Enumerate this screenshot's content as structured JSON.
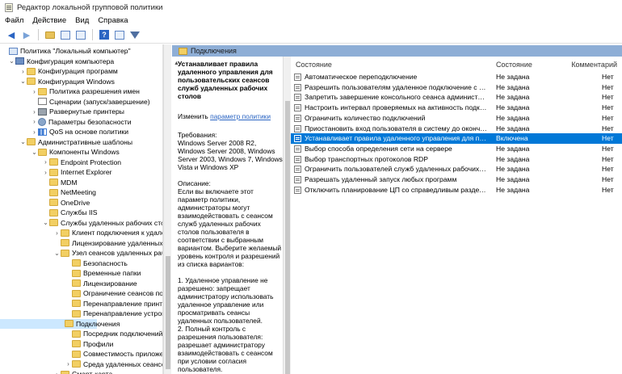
{
  "window": {
    "title": "Редактор локальной групповой политики"
  },
  "menu": [
    "Файл",
    "Действие",
    "Вид",
    "Справка"
  ],
  "tree": [
    {
      "label": "Политика \"Локальный компьютер\"",
      "level": 0,
      "chev": "",
      "icon": "policy"
    },
    {
      "label": "Конфигурация компьютера",
      "level": 1,
      "chev": "⌄",
      "icon": "pc"
    },
    {
      "label": "Конфигурация программ",
      "level": 2,
      "chev": "›",
      "icon": "folder"
    },
    {
      "label": "Конфигурация Windows",
      "level": 2,
      "chev": "⌄",
      "icon": "folder"
    },
    {
      "label": "Политика разрешения имен",
      "level": 3,
      "chev": "›",
      "icon": "folder"
    },
    {
      "label": "Сценарии (запуск/завершение)",
      "level": 3,
      "chev": "",
      "icon": "doc"
    },
    {
      "label": "Развернутые принтеры",
      "level": 3,
      "chev": "›",
      "icon": "printer"
    },
    {
      "label": "Параметры безопасности",
      "level": 3,
      "chev": "›",
      "icon": "gear"
    },
    {
      "label": "QoS на основе политики",
      "level": 3,
      "chev": "›",
      "icon": "chart"
    },
    {
      "label": "Административные шаблоны",
      "level": 2,
      "chev": "⌄",
      "icon": "folder"
    },
    {
      "label": "Компоненты Windows",
      "level": 3,
      "chev": "⌄",
      "icon": "folder"
    },
    {
      "label": "Endpoint Protection",
      "level": 4,
      "chev": "›",
      "icon": "folder"
    },
    {
      "label": "Internet Explorer",
      "level": 4,
      "chev": "›",
      "icon": "folder"
    },
    {
      "label": "MDM",
      "level": 4,
      "chev": "",
      "icon": "folder"
    },
    {
      "label": "NetMeeting",
      "level": 4,
      "chev": "",
      "icon": "folder"
    },
    {
      "label": "OneDrive",
      "level": 4,
      "chev": "",
      "icon": "folder"
    },
    {
      "label": "Службы IIS",
      "level": 4,
      "chev": "",
      "icon": "folder"
    },
    {
      "label": "Службы удаленных рабочих стол",
      "level": 4,
      "chev": "⌄",
      "icon": "folder"
    },
    {
      "label": "Клиент подключения к удале",
      "level": 5,
      "chev": "›",
      "icon": "folder"
    },
    {
      "label": "Лицензирование удаленных р",
      "level": 5,
      "chev": "",
      "icon": "folder"
    },
    {
      "label": "Узел сеансов удаленных рабс",
      "level": 5,
      "chev": "⌄",
      "icon": "folder"
    },
    {
      "label": "Безопасность",
      "level": 6,
      "chev": "",
      "icon": "folder"
    },
    {
      "label": "Временные папки",
      "level": 6,
      "chev": "",
      "icon": "folder"
    },
    {
      "label": "Лицензирование",
      "level": 6,
      "chev": "",
      "icon": "folder"
    },
    {
      "label": "Ограничение сеансов по",
      "level": 6,
      "chev": "",
      "icon": "folder"
    },
    {
      "label": "Перенаправление принте",
      "level": 6,
      "chev": "",
      "icon": "folder"
    },
    {
      "label": "Перенаправление устрой",
      "level": 6,
      "chev": "",
      "icon": "folder"
    },
    {
      "label": "Подключения",
      "level": 6,
      "chev": "",
      "icon": "folder",
      "selected": true
    },
    {
      "label": "Посредник подключений",
      "level": 6,
      "chev": "",
      "icon": "folder"
    },
    {
      "label": "Профили",
      "level": 6,
      "chev": "",
      "icon": "folder"
    },
    {
      "label": "Совместимость приложе",
      "level": 6,
      "chev": "",
      "icon": "folder"
    },
    {
      "label": "Среда удаленных сеансов",
      "level": 6,
      "chev": "›",
      "icon": "folder"
    },
    {
      "label": "Смарт-карта",
      "level": 5,
      "chev": "›",
      "icon": "folder"
    }
  ],
  "header": {
    "folder_label": "Подключения"
  },
  "description": {
    "policy_name": "Устанавливает правила удаленного управления для пользовательских сеансов служб удаленных рабочих столов",
    "edit_prefix": "Изменить ",
    "edit_link": "параметр политики",
    "requirements": "Требования:\nWindows Server 2008 R2, Windows Server 2008, Windows Server 2003, Windows 7, Windows Vista и Windows XP",
    "description": "Описание:\nЕсли вы включаете этот параметр политики, администраторы могут взаимодействовать с сеансом служб удаленных рабочих столов пользователя в соответствии с выбранным вариантом. Выберите желаемый уровень контроля и разрешений из списка вариантов:\n\n1. Удаленное управление не разрешено: запрещает администратору использовать удаленное управление или просматривать сеансы удаленных пользователей.\n2. Полный контроль с разрешения пользователя: разрешает администратору взаимодействовать с сеансом при условии согласия пользователя."
  },
  "list": {
    "headers": {
      "name": "Состояние",
      "state": "Состояние",
      "comment": "Комментарий"
    },
    "rows": [
      {
        "name": "Автоматическое переподключение",
        "state": "Не задана",
        "comment": "Нет"
      },
      {
        "name": "Разрешить пользователям удаленное подключение с ис...",
        "state": "Не задана",
        "comment": "Нет"
      },
      {
        "name": "Запретить завершение консольного сеанса администрат...",
        "state": "Не задана",
        "comment": "Нет"
      },
      {
        "name": "Настроить интервал проверяемых на активность подклю...",
        "state": "Не задана",
        "comment": "Нет"
      },
      {
        "name": "Ограничить количество подключений",
        "state": "Не задана",
        "comment": "Нет"
      },
      {
        "name": "Приостановить вход пользователя в систему до окончан...",
        "state": "Не задана",
        "comment": "Нет"
      },
      {
        "name": "Устанавливает правила удаленного управления для польз...",
        "state": "Включена",
        "comment": "Нет",
        "selected": true
      },
      {
        "name": "Выбор способа определения сети на сервере",
        "state": "Не задана",
        "comment": "Нет"
      },
      {
        "name": "Выбор транспортных протоколов RDP",
        "state": "Не задана",
        "comment": "Нет"
      },
      {
        "name": "Ограничить пользователей служб удаленных рабочих ст...",
        "state": "Не задана",
        "comment": "Нет"
      },
      {
        "name": "Разрешать удаленный запуск любых программ",
        "state": "Не задана",
        "comment": "Нет"
      },
      {
        "name": "Отключить планирование ЦП со справедливым разделе...",
        "state": "Не задана",
        "comment": "Нет"
      }
    ]
  }
}
